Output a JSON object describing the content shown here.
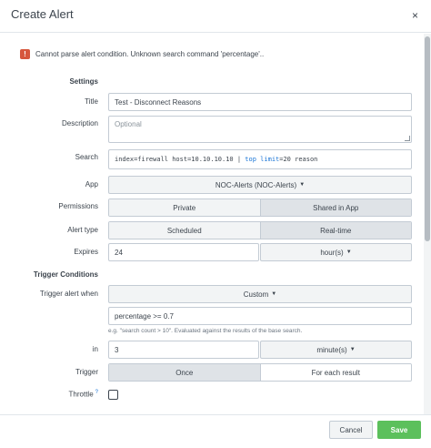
{
  "dialog": {
    "title": "Create Alert",
    "close_glyph": "×"
  },
  "error": {
    "icon": "!",
    "message": "Cannot parse alert condition. Unknown search command 'percentage'.."
  },
  "settings": {
    "section_title": "Settings",
    "title_label": "Title",
    "title_value": "Test - Disconnect Reasons",
    "description_label": "Description",
    "description_placeholder": "Optional",
    "search_label": "Search",
    "search_prefix": "index=firewall host=10.10.10.10 | ",
    "search_kw1": "top",
    "search_space": " ",
    "search_kw2": "limit",
    "search_suffix": "=20 reason",
    "app_label": "App",
    "app_value": "NOC-Alerts (NOC-Alerts)",
    "permissions_label": "Permissions",
    "permissions_options": [
      "Private",
      "Shared in App"
    ],
    "permissions_selected": "Shared in App",
    "alert_type_label": "Alert type",
    "alert_type_options": [
      "Scheduled",
      "Real-time"
    ],
    "alert_type_selected": "Real-time",
    "expires_label": "Expires",
    "expires_value": "24",
    "expires_unit": "hour(s)"
  },
  "trigger": {
    "section_title": "Trigger Conditions",
    "when_label": "Trigger alert when",
    "when_value": "Custom",
    "condition_value": "percentage >= 0.7",
    "condition_help": "e.g. \"search count > 10\". Evaluated against the results of the base search.",
    "in_label": "in",
    "in_value": "3",
    "in_unit": "minute(s)",
    "trigger_label": "Trigger",
    "trigger_options": [
      "Once",
      "For each result"
    ],
    "trigger_selected": "Once",
    "throttle_label": "Throttle",
    "throttle_help_glyph": "?",
    "throttle_checked": false
  },
  "footer": {
    "cancel_label": "Cancel",
    "save_label": "Save"
  },
  "colors": {
    "save": "#5cc05c",
    "error": "#d6563c",
    "link": "#1a75d6"
  }
}
